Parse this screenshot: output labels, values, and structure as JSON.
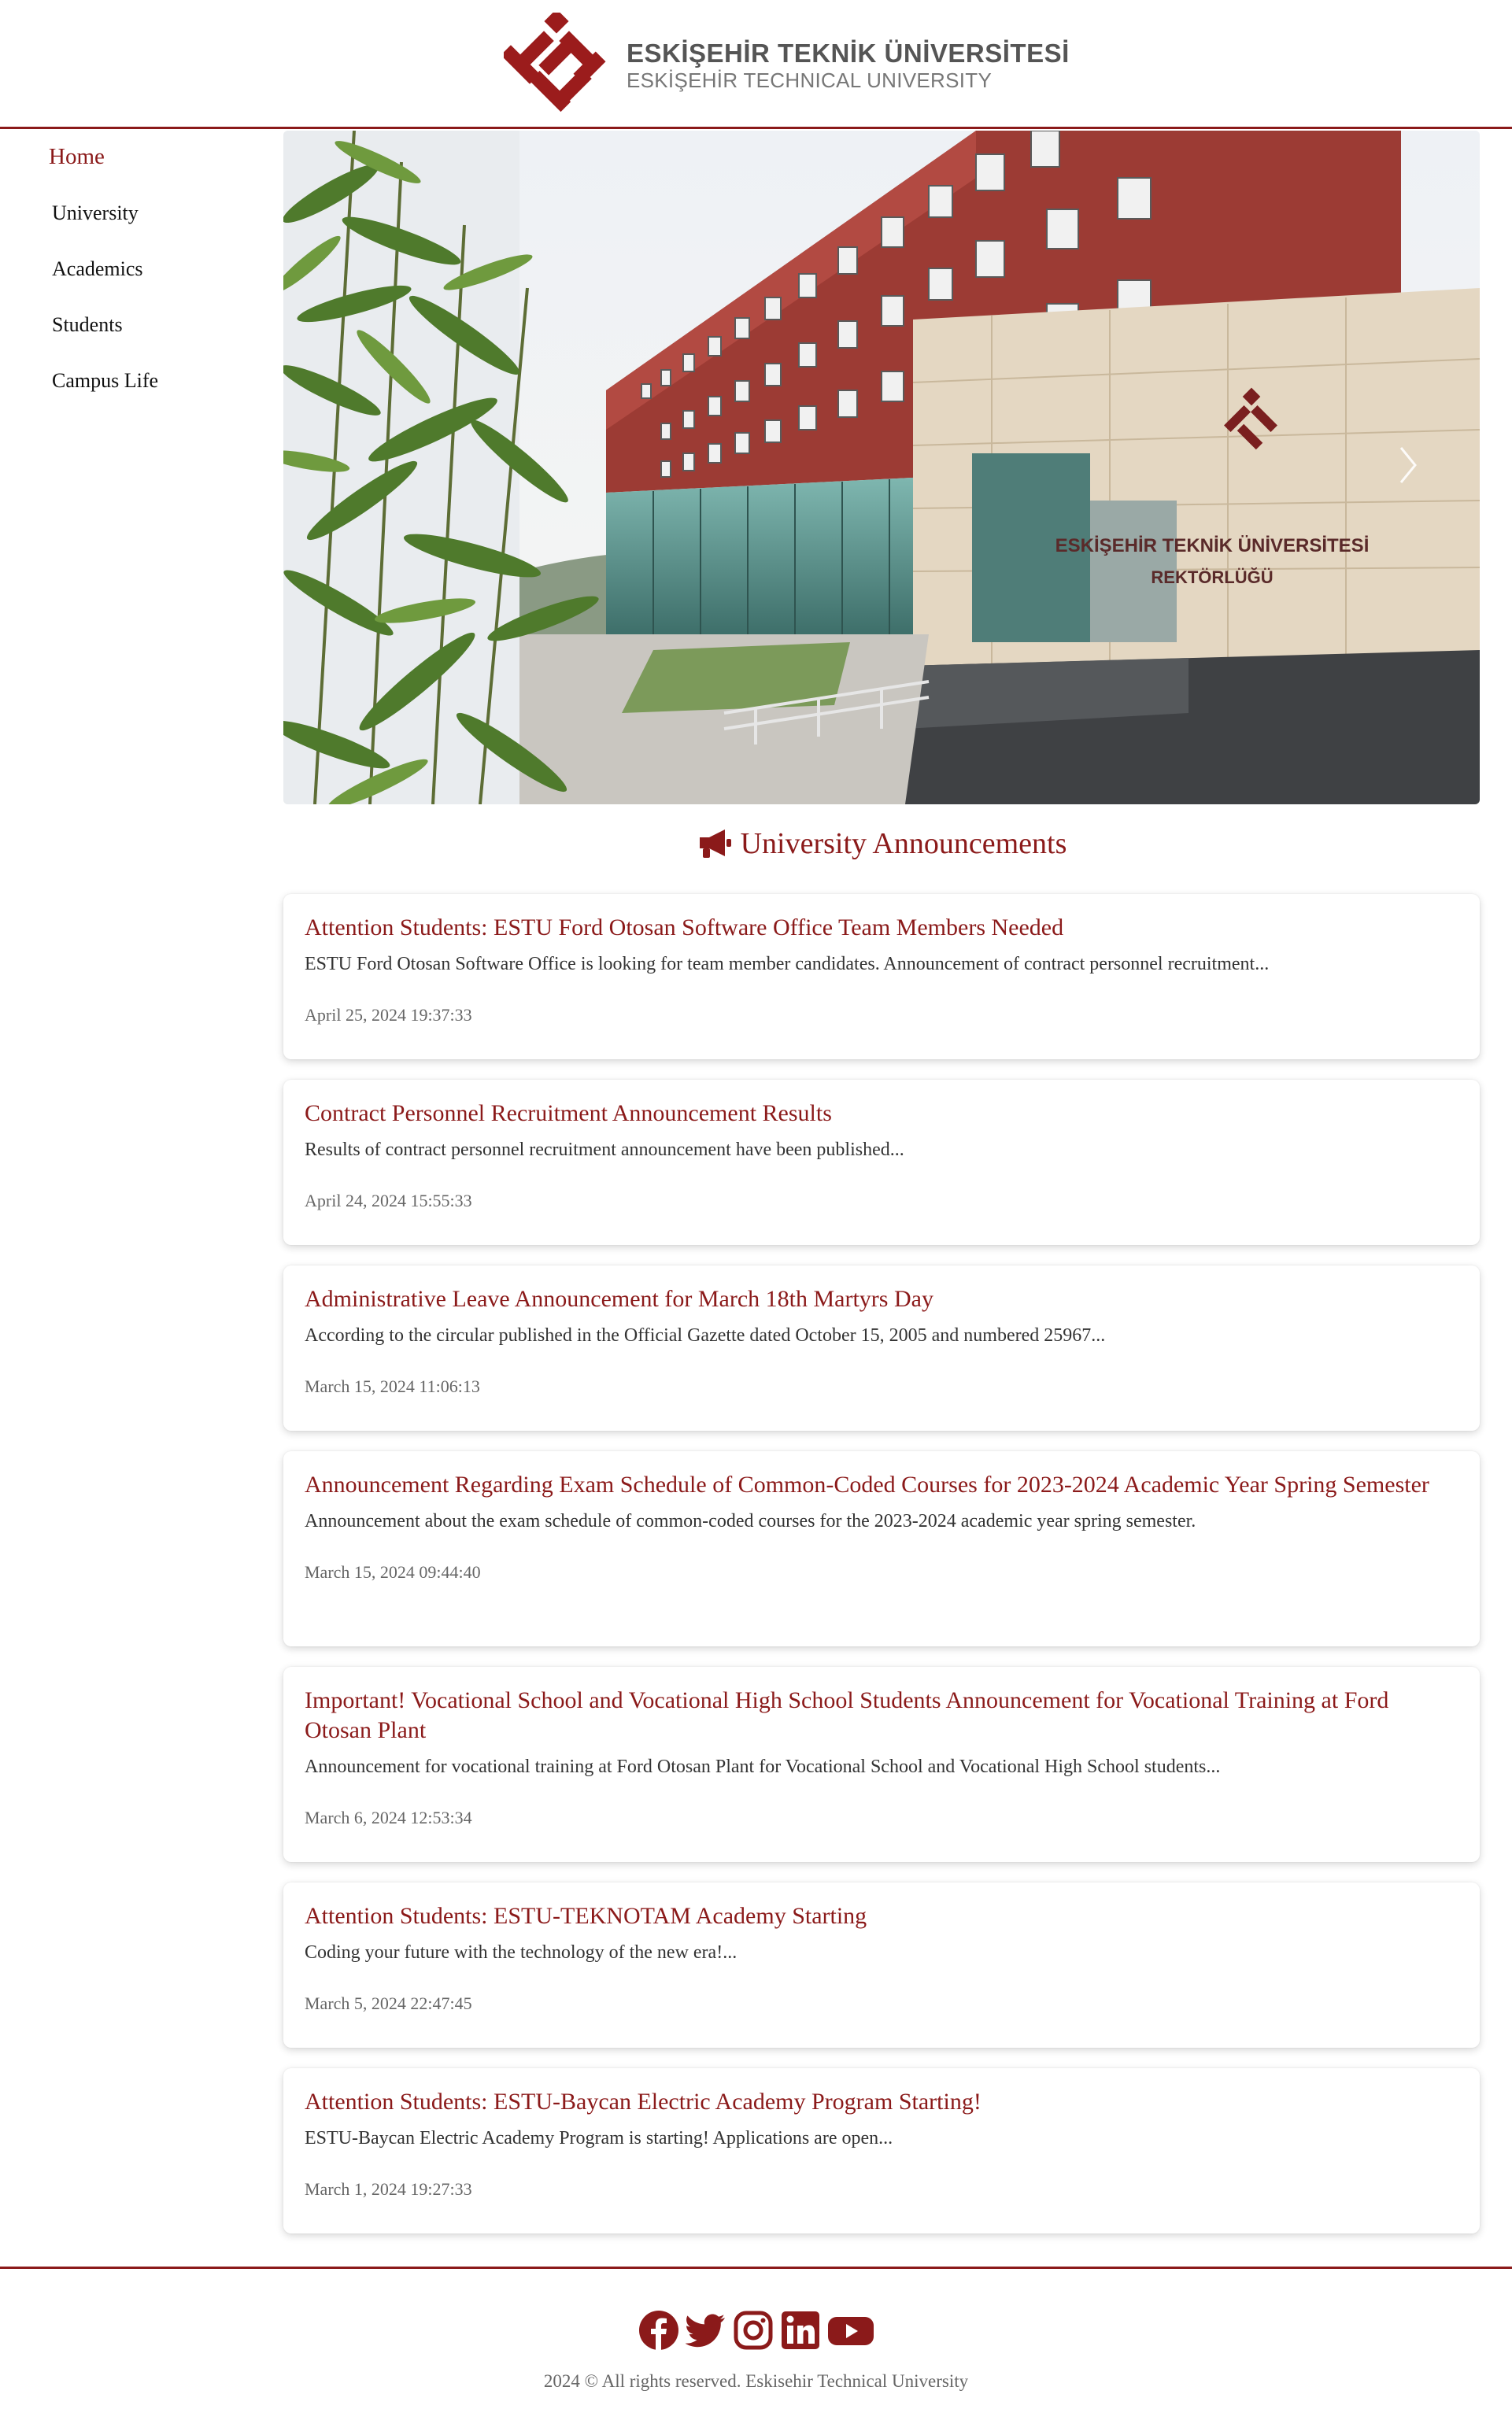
{
  "header": {
    "logo_title_tr": "ESKİŞEHİR TEKNİK ÜNİVERSİTESİ",
    "logo_title_en": "ESKİŞEHİR TECHNICAL UNIVERSITY"
  },
  "sidebar": {
    "items": [
      {
        "label": "Home",
        "active": true
      },
      {
        "label": "University",
        "active": false
      },
      {
        "label": "Academics",
        "active": false
      },
      {
        "label": "Students",
        "active": false
      },
      {
        "label": "Campus Life",
        "active": false
      }
    ]
  },
  "hero": {
    "sign_line1": "ESKİŞEHİR TEKNİK ÜNİVERSİTESİ",
    "sign_line2": "REKTÖRLÜĞÜ",
    "next_icon": "chevron-right-icon"
  },
  "announcements": {
    "heading": "University Announcements",
    "heading_icon": "megaphone-icon",
    "items": [
      {
        "title": "Attention Students: ESTU Ford Otosan Software Office Team Members Needed",
        "summary": "ESTU Ford Otosan Software Office is looking for team member candidates. Announcement of contract personnel recruitment...",
        "date": "April 25, 2024 19:37:33"
      },
      {
        "title": "Contract Personnel Recruitment Announcement Results",
        "summary": "Results of contract personnel recruitment announcement have been published...",
        "date": "April 24, 2024 15:55:33"
      },
      {
        "title": "Administrative Leave Announcement for March 18th Martyrs Day",
        "summary": "According to the circular published in the Official Gazette dated October 15, 2005 and numbered 25967...",
        "date": "March 15, 2024 11:06:13"
      },
      {
        "title": "Announcement Regarding Exam Schedule of Common-Coded Courses for 2023-2024 Academic Year Spring Semester",
        "summary": "Announcement about the exam schedule of common-coded courses for the 2023-2024 academic year spring semester.",
        "date": "March 15, 2024 09:44:40"
      },
      {
        "title": "Important! Vocational School and Vocational High School Students Announcement for Vocational Training at Ford Otosan Plant",
        "summary": "Announcement for vocational training at Ford Otosan Plant for Vocational School and Vocational High School students...",
        "date": "March 6, 2024 12:53:34"
      },
      {
        "title": "Attention Students: ESTU-TEKNOTAM Academy Starting",
        "summary": "Coding your future with the technology of the new era!...",
        "date": "March 5, 2024 22:47:45"
      },
      {
        "title": "Attention Students: ESTU-Baycan Electric Academy Program Starting!",
        "summary": "ESTU-Baycan Electric Academy Program is starting! Applications are open...",
        "date": "March 1, 2024 19:27:33"
      }
    ]
  },
  "footer": {
    "socials": [
      "facebook-icon",
      "twitter-icon",
      "instagram-icon",
      "linkedin-icon",
      "youtube-icon"
    ],
    "copyright": "2024 © All rights reserved. Eskisehir Technical University"
  },
  "colors": {
    "brand": "#8b1a1a",
    "text": "#222222",
    "muted": "#666666"
  }
}
